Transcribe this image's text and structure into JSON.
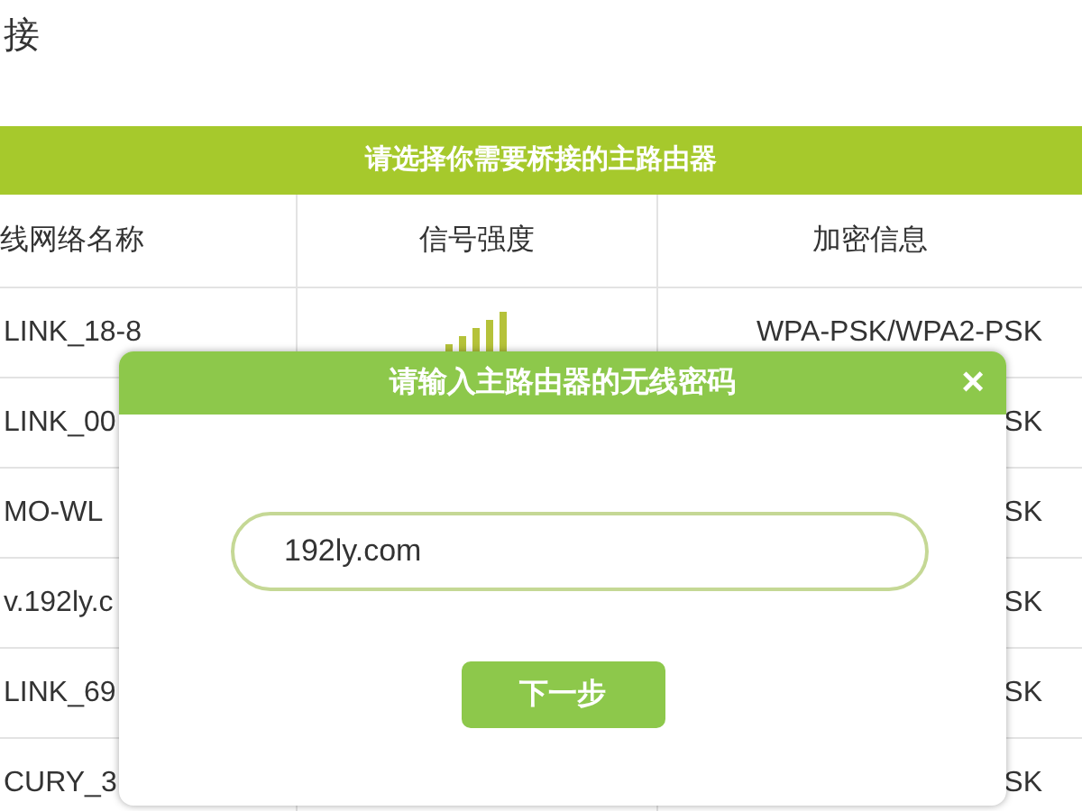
{
  "page_title": "接",
  "table": {
    "caption": "请选择你需要桥接的主路由器",
    "columns": [
      "线网络名称",
      "信号强度",
      "加密信息"
    ],
    "rows": [
      {
        "name": "LINK_18-8",
        "signal": true,
        "encryption": "WPA-PSK/WPA2-PSK"
      },
      {
        "name": "LINK_00",
        "signal": false,
        "encryption": "SK"
      },
      {
        "name": "MO-WL",
        "signal": false,
        "encryption": "SK"
      },
      {
        "name": "v.192ly.c",
        "signal": false,
        "encryption": "SK"
      },
      {
        "name": "LINK_69",
        "signal": false,
        "encryption": "SK"
      },
      {
        "name": "CURY_3",
        "signal": false,
        "encryption": "SK"
      }
    ]
  },
  "dialog": {
    "title": "请输入主路由器的无线密码",
    "close": "×",
    "password": {
      "value": "192ly.com"
    },
    "button": "下一步"
  }
}
